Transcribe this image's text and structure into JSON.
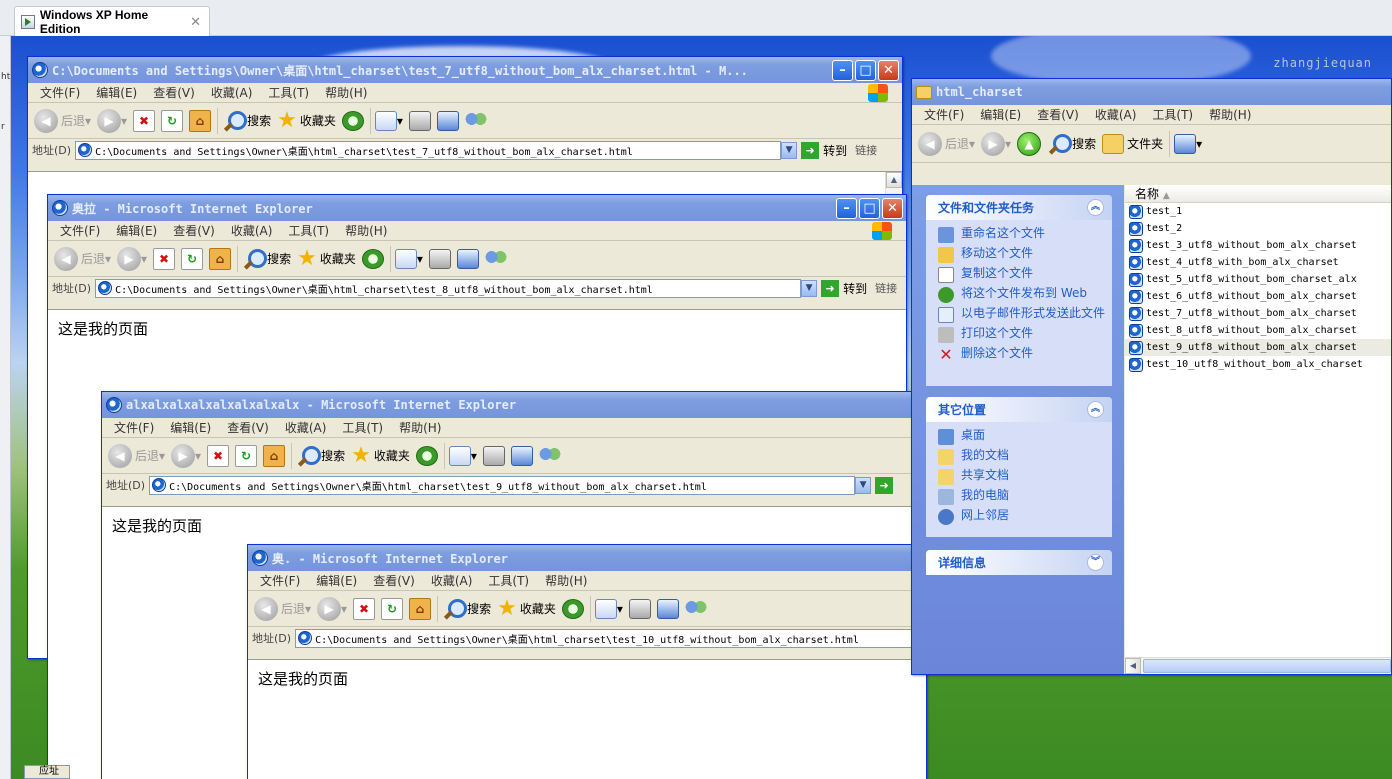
{
  "host": {
    "tab_title": "Windows XP Home Edition",
    "tab_close": "✕",
    "side_marks": [
      "ht",
      "r"
    ]
  },
  "desktop": {
    "watermark": "zhangjiequan"
  },
  "ie_menu": [
    "文件(F)",
    "编辑(E)",
    "查看(V)",
    "收藏(A)",
    "工具(T)",
    "帮助(H)"
  ],
  "ie_toolbar": {
    "back": "后退",
    "search": "搜索",
    "favorites": "收藏夹"
  },
  "ie_address": {
    "label": "地址(D)",
    "go": "转到",
    "links": "链接"
  },
  "windows": [
    {
      "title": "C:\\Documents and Settings\\Owner\\桌面\\html_charset\\test_7_utf8_without_bom_alx_charset.html - M...",
      "address": "C:\\Documents and Settings\\Owner\\桌面\\html_charset\\test_7_utf8_without_bom_alx_charset.html",
      "page_text": ""
    },
    {
      "title": "奥拉 - Microsoft Internet Explorer",
      "address": "C:\\Documents and Settings\\Owner\\桌面\\html_charset\\test_8_utf8_without_bom_alx_charset.html",
      "page_text": "这是我的页面"
    },
    {
      "title": "alxalxalxalxalxalxalxalx - Microsoft Internet Explorer",
      "address": "C:\\Documents and Settings\\Owner\\桌面\\html_charset\\test_9_utf8_without_bom_alx_charset.html",
      "page_text": "这是我的页面"
    },
    {
      "title": "奥. - Microsoft Internet Explorer",
      "address": "C:\\Documents and Settings\\Owner\\桌面\\html_charset\\test_10_utf8_without_bom_alx_charset.html",
      "page_text": "这是我的页面"
    }
  ],
  "explorer": {
    "title": "html_charset",
    "menu": [
      "文件(F)",
      "编辑(E)",
      "查看(V)",
      "收藏(A)",
      "工具(T)",
      "帮助(H)"
    ],
    "toolbar": {
      "back": "后退",
      "search": "搜索",
      "folders": "文件夹"
    },
    "tasks_panel": {
      "title": "文件和文件夹任务",
      "items": [
        "重命名这个文件",
        "移动这个文件",
        "复制这个文件",
        "将这个文件发布到 Web",
        "以电子邮件形式发送此文件",
        "打印这个文件",
        "删除这个文件"
      ]
    },
    "places_panel": {
      "title": "其它位置",
      "items": [
        "桌面",
        "我的文档",
        "共享文档",
        "我的电脑",
        "网上邻居"
      ]
    },
    "details_panel": {
      "title": "详细信息"
    },
    "column_header": "名称",
    "files": [
      "test_1",
      "test_2",
      "test_3_utf8_without_bom_alx_charset",
      "test_4_utf8_with_bom_alx_charset",
      "test_5_utf8_without_bom_charset_alx",
      "test_6_utf8_without_bom_alx_charset",
      "test_7_utf8_without_bom_alx_charset",
      "test_8_utf8_without_bom_alx_charset",
      "test_9_utf8_without_bom_alx_charset",
      "test_10_utf8_without_bom_alx_charset"
    ],
    "selected_file_index": 8
  },
  "taskbar_stub": "应址"
}
